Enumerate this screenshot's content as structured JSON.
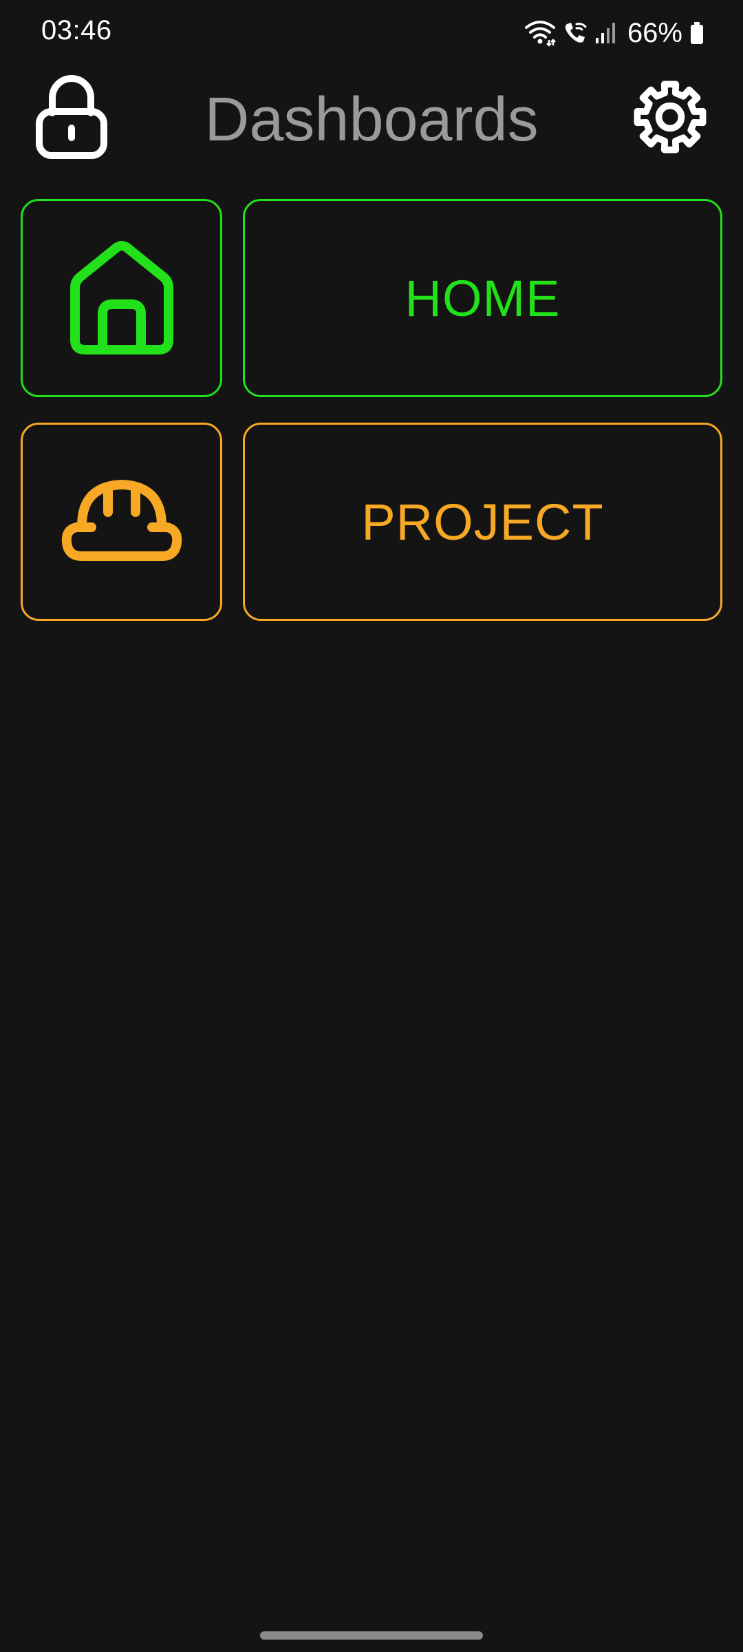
{
  "status_bar": {
    "time": "03:46",
    "battery": "66%",
    "icons": [
      "wifi-icon",
      "wifi-calling-icon",
      "signal-icon",
      "battery-icon"
    ]
  },
  "header": {
    "title": "Dashboards",
    "left_icon": "lock-icon",
    "right_icon": "gear-icon"
  },
  "dashboards": [
    {
      "label": "HOME",
      "icon": "house-icon",
      "color": "#22e01a"
    },
    {
      "label": "PROJECT",
      "icon": "hard-hat-icon",
      "color": "#f7a825"
    }
  ],
  "colors": {
    "background": "#141414",
    "title": "#9a9a9a"
  }
}
